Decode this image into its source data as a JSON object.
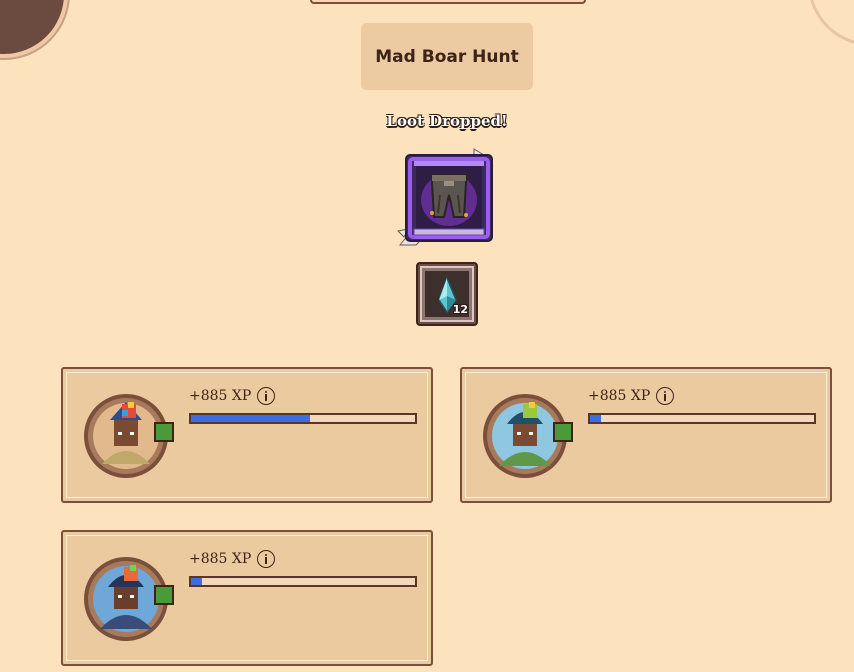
{
  "hunt": {
    "title": "Mad Boar Hunt"
  },
  "loot": {
    "label": "Loot Dropped!",
    "gear": {
      "icon": "armor-pants-icon",
      "rarity_color": "#7a3ad9"
    },
    "material": {
      "icon": "crystal-shard-icon",
      "count": "12"
    }
  },
  "party": [
    {
      "xp_text": "+885 XP",
      "xp_progress": 0.53,
      "portrait_bg": "#e2b98c",
      "outfit_color": "#c0a86b"
    },
    {
      "xp_text": "+885 XP",
      "xp_progress": 0.05,
      "portrait_bg": "#8fc6e0",
      "outfit_color": "#5e9848"
    },
    {
      "xp_text": "+885 XP",
      "xp_progress": 0.05,
      "portrait_bg": "#6fa8d8",
      "outfit_color": "#3a4c7a"
    }
  ],
  "colors": {
    "background": "#fde3bd",
    "card": "#ecca9f",
    "xp_bar_fill": "#3a6fe2",
    "level_badge": "#4a9a3a"
  }
}
